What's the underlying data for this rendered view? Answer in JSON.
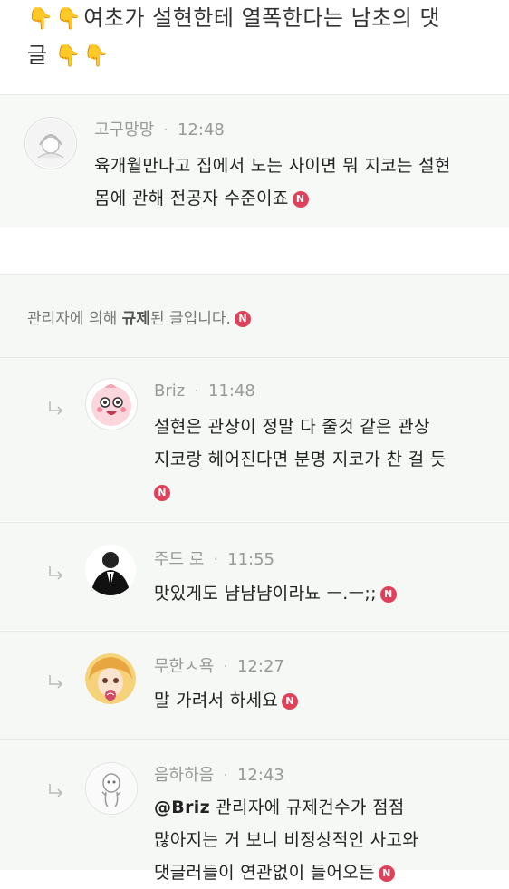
{
  "post": {
    "title_line1": "여초가 설현한테 열폭한다는 남초의 댓",
    "title_line2": "글"
  },
  "comments": [
    {
      "author": "고구망망",
      "time": "12:48",
      "text_line1": "육개월만나고 집에서 노는 사이면 뭐 지코는 설현",
      "text_line2": "몸에 관해 전공자 수준이죠",
      "badge": "N"
    }
  ],
  "admin_notice": {
    "prefix": "관리자에 의해",
    "bold": "규제",
    "suffix": "된 글입니다.",
    "badge": "N"
  },
  "replies": [
    {
      "author": "Briz",
      "time": "11:48",
      "text_line1": "설현은 관상이 정말 다 줄것 같은 관상",
      "text_line2": "지코랑 헤어진다면 분명 지코가 찬 걸 듯",
      "badge": "N"
    },
    {
      "author": "주드 로",
      "time": "11:55",
      "text_line1": "맛있게도 냠냠냠이라뇨 ㅡ.ㅡ;;",
      "badge": "N"
    },
    {
      "author": "무한ㅅ욕",
      "time": "12:27",
      "text_line1": "말 가려서 하세요",
      "badge": "N"
    },
    {
      "author": "음하하음",
      "time": "12:43",
      "mention": "@Briz",
      "text_line1": "관리자에 규제건수가 점점",
      "text_line2": "많아지는 거 보니 비정상적인 사고와",
      "text_line3": "댓글러들이 연관없이 들어오든",
      "badge": "N"
    }
  ],
  "icons": {
    "reply_arrow": "reply-arrow-icon",
    "new_badge": "new-badge-icon",
    "pointing_hand": "pointing-down-hand-icon"
  },
  "colors": {
    "badge": "#e0415a",
    "row_bg": "#f5f8f5",
    "meta": "#9a9a9a"
  }
}
